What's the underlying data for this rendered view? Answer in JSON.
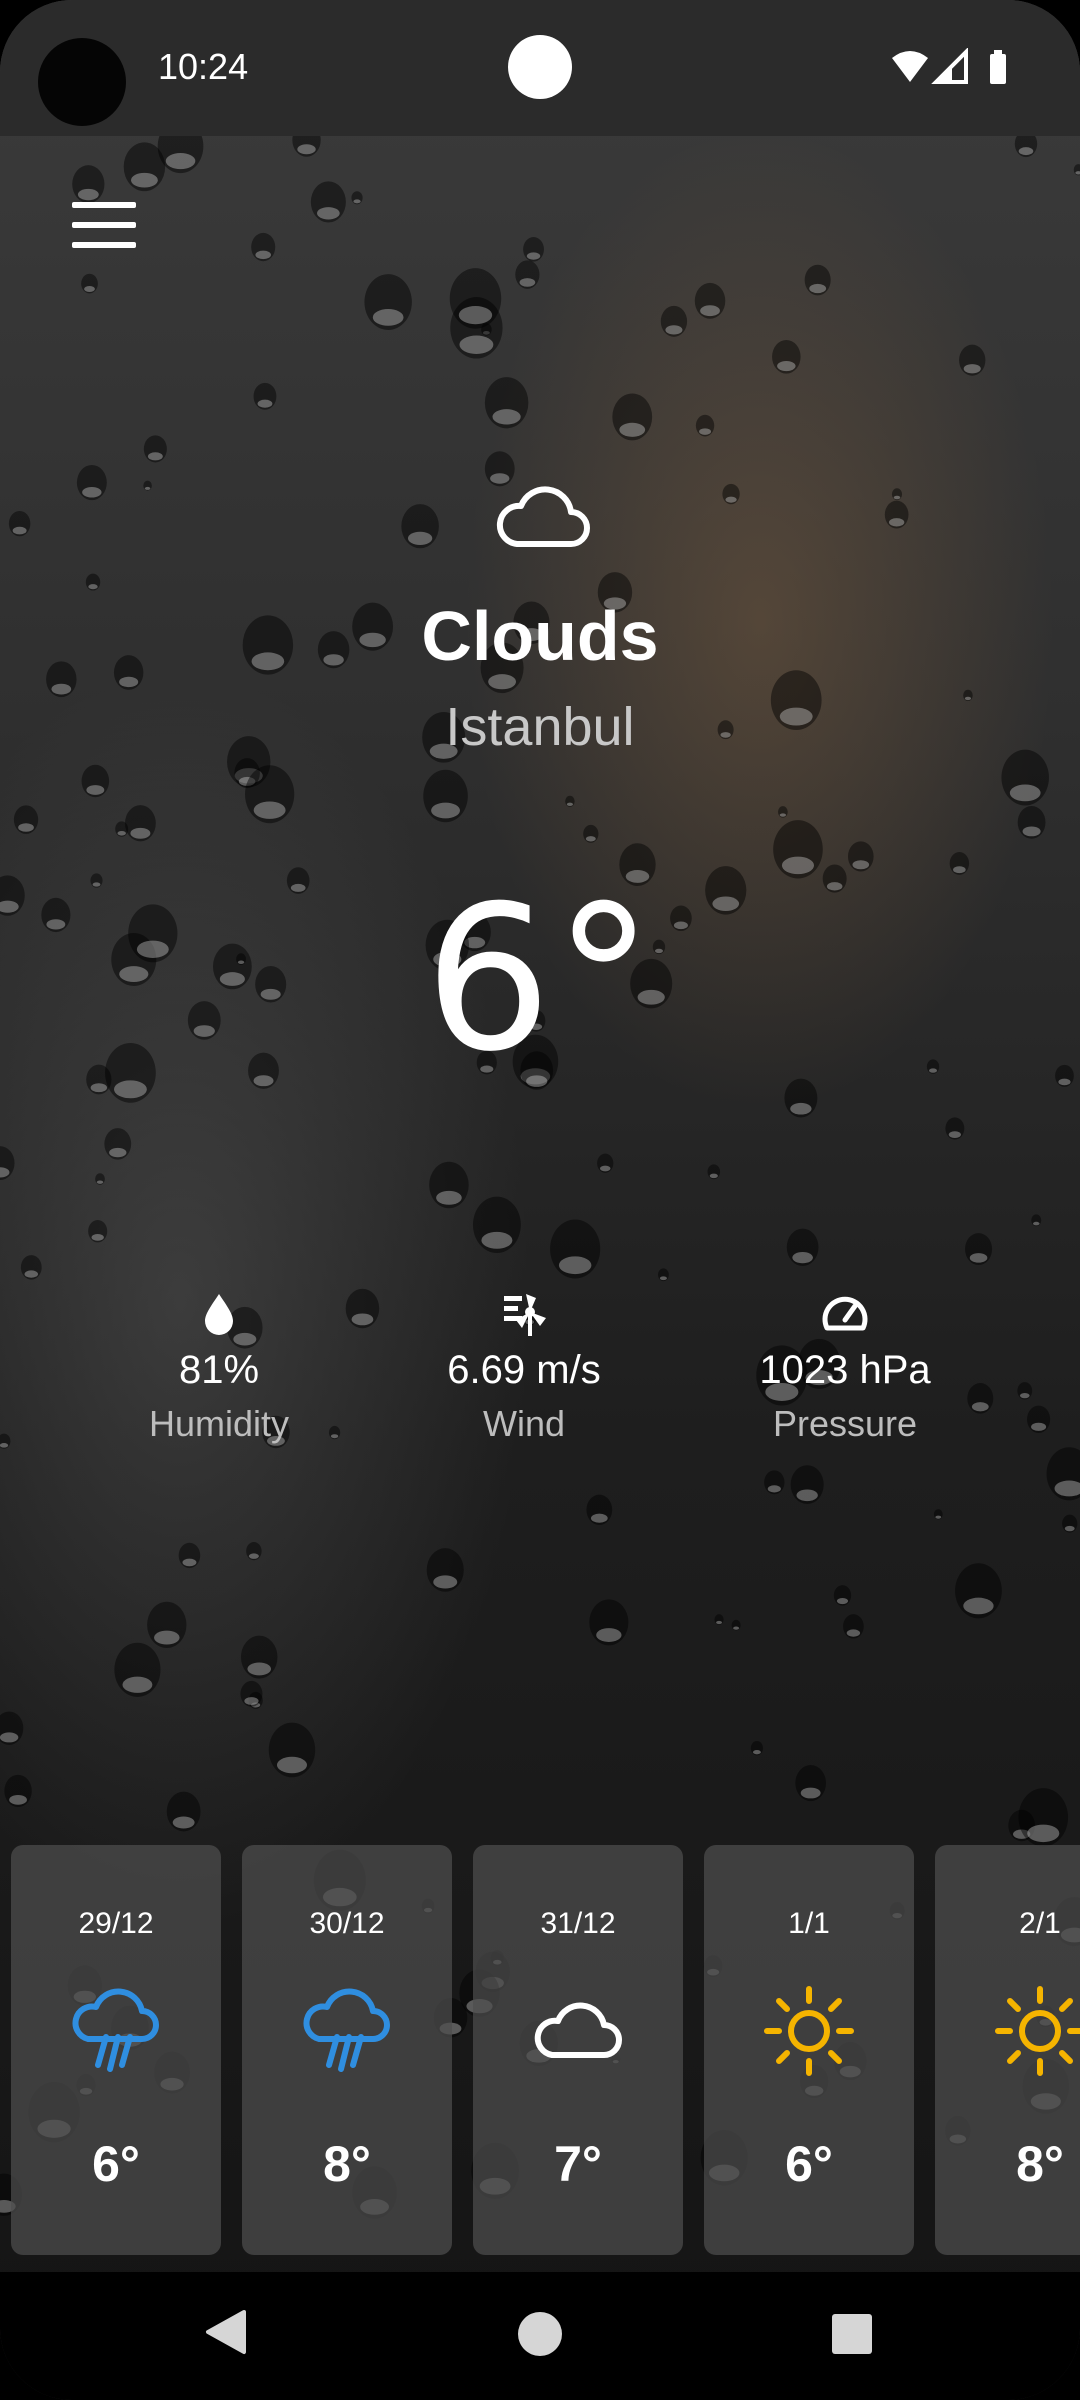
{
  "status_bar": {
    "time": "10:24",
    "icons": [
      "wifi-icon",
      "signal-icon",
      "battery-icon"
    ]
  },
  "header": {
    "menu_icon": "hamburger-menu-icon"
  },
  "current": {
    "icon": "cloud-icon",
    "condition": "Clouds",
    "city": "Istanbul",
    "temperature": "6°"
  },
  "stats": [
    {
      "icon": "water-drop-icon",
      "value": "81%",
      "label": "Humidity"
    },
    {
      "icon": "wind-icon",
      "value": "6.69 m/s",
      "label": "Wind"
    },
    {
      "icon": "gauge-icon",
      "value": "1023 hPa",
      "label": "Pressure"
    }
  ],
  "forecast": [
    {
      "date": "29/12",
      "icon": "rain-icon",
      "temp": "6°"
    },
    {
      "date": "30/12",
      "icon": "rain-icon",
      "temp": "8°"
    },
    {
      "date": "31/12",
      "icon": "cloud-icon",
      "temp": "7°"
    },
    {
      "date": "1/1",
      "icon": "sun-icon",
      "temp": "6°"
    },
    {
      "date": "2/1",
      "icon": "sun-icon",
      "temp": "8°"
    }
  ],
  "colors": {
    "rain_icon": "#2f8ee0",
    "sun_icon": "#f5b400",
    "card_bg": "#4e4e4e",
    "nav_bar": "#000000"
  },
  "nav_bar": {
    "buttons": [
      "back-icon",
      "home-icon",
      "recents-icon"
    ]
  }
}
